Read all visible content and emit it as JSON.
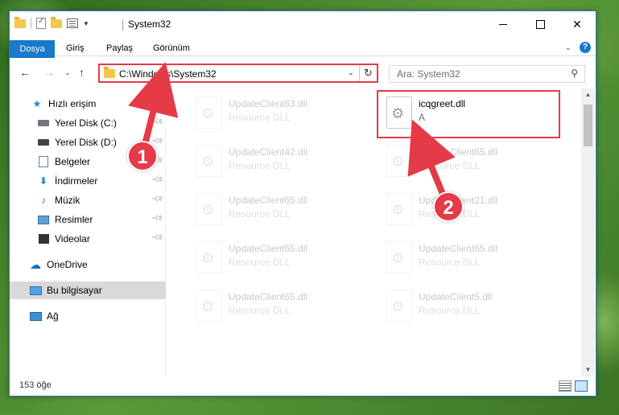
{
  "window": {
    "title": "System32"
  },
  "ribbon": {
    "tabs": [
      "Dosya",
      "Giriş",
      "Paylaş",
      "Görünüm"
    ],
    "help": "?"
  },
  "navbar": {
    "address": "C:\\Windows\\System32",
    "search_placeholder": "Ara: System32"
  },
  "sidebar": {
    "items": [
      {
        "label": "Hızlı erişim",
        "icon": "star-icon"
      },
      {
        "label": "Yerel Disk (C:)",
        "icon": "drive-icon",
        "pinned": true
      },
      {
        "label": "Yerel Disk (D:)",
        "icon": "drive-icon",
        "pinned": true
      },
      {
        "label": "Belgeler",
        "icon": "documents-icon",
        "pinned": true
      },
      {
        "label": "İndirmeler",
        "icon": "downloads-icon",
        "pinned": true
      },
      {
        "label": "Müzik",
        "icon": "music-icon",
        "pinned": true
      },
      {
        "label": "Resimler",
        "icon": "pictures-icon",
        "pinned": true
      },
      {
        "label": "Videolar",
        "icon": "videos-icon",
        "pinned": true
      },
      {
        "label": "OneDrive",
        "icon": "cloud-icon"
      },
      {
        "label": "Bu bilgisayar",
        "icon": "computer-icon",
        "selected": true
      },
      {
        "label": "Ağ",
        "icon": "network-icon"
      }
    ]
  },
  "files": [
    {
      "name": "UpdateClient63.dll",
      "desc": "Resource DLL"
    },
    {
      "name": "icqgreet.dll",
      "desc": "A",
      "highlighted": true
    },
    {
      "name": "UpdateClient42.dll",
      "desc": "Resource DLL"
    },
    {
      "name": "UpdateClient65.dll",
      "desc": "Resource DLL"
    },
    {
      "name": "UpdateClient65.dll",
      "desc": "Resource DLL"
    },
    {
      "name": "UpdateClient21.dll",
      "desc": "Resource DLL"
    },
    {
      "name": "UpdateClient65.dll",
      "desc": "Resource DLL"
    },
    {
      "name": "UpdateClient65.dll",
      "desc": "Resource DLL"
    },
    {
      "name": "UpdateClient65.dll",
      "desc": "Resource DLL"
    },
    {
      "name": "UpdateClient5.dll",
      "desc": "Resource DLL"
    }
  ],
  "status": {
    "count": "153 öğe"
  },
  "annotations": {
    "step1": "1",
    "step2": "2",
    "color": "#e53a48"
  }
}
